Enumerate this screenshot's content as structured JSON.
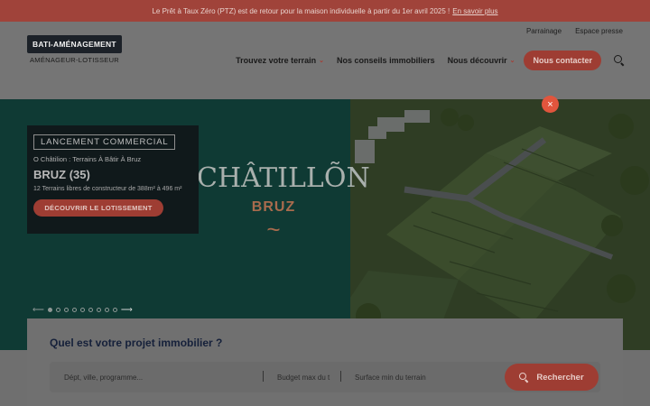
{
  "announcement": {
    "text": "Le Prêt à Taux Zéro (PTZ) est de retour pour la maison individuelle à partir du 1er avril 2025 !",
    "link": "En savoir plus"
  },
  "util_nav": [
    "Parrainage",
    "Espace presse"
  ],
  "logo": {
    "name": "BATI-AMÉNAGEMENT",
    "tagline": "AMÉNAGEUR-LOTISSEUR"
  },
  "nav": {
    "terrain": "Trouvez votre terrain",
    "conseils": "Nos conseils immobiliers",
    "decouvrir": "Nous découvrir",
    "contact": "Nous contacter",
    "search_icon": "search-icon"
  },
  "hero": {
    "brand_name": "CHÂTILLÕN",
    "brand_city": "BRUZ",
    "brand_wave": "~",
    "promo": {
      "tag": "LANCEMENT COMMERCIAL",
      "subtitle": "O Châtilion : Terrains À Bâtir À Bruz",
      "title": "BRUZ (35)",
      "description": "12 Terrains libres de constructeur de 388m² à 496 m²",
      "button": "DÉCOUVRIR LE LOTISSEMENT"
    },
    "close_label": "×",
    "prev_arrow": "⟵",
    "next_arrow": "⟶",
    "slides_count": 9,
    "active_slide": 1
  },
  "search": {
    "heading": "Quel est votre projet immobilier ?",
    "location_placeholder": "Dépt, ville, programme...",
    "budget_placeholder": "Budget max du t",
    "surface_placeholder": "Surface min du terrain",
    "button": "Rechercher"
  },
  "colors": {
    "brand_red": "#9e3d33",
    "hero_green": "#0f3a34",
    "accent_close": "#e1553d"
  }
}
